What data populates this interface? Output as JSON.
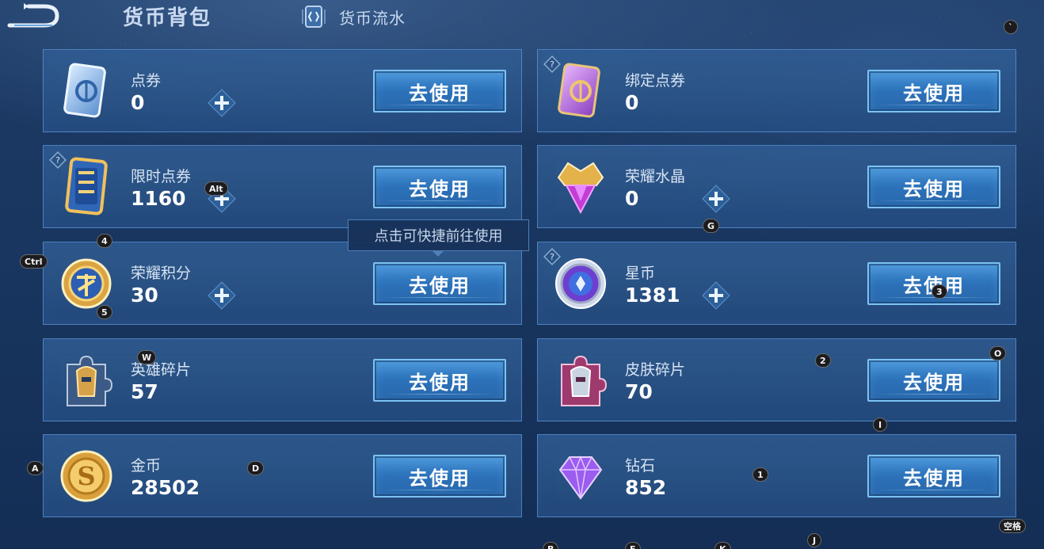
{
  "header": {
    "title": "货币背包",
    "ledger_label": "货币流水"
  },
  "cards": [
    {
      "name": "点券",
      "amount": "0",
      "button": "去使用",
      "icon": "coupon-card-icon",
      "has_plus": true,
      "has_help": false
    },
    {
      "name": "绑定点券",
      "amount": "0",
      "button": "去使用",
      "icon": "bound-coupon-icon",
      "has_plus": false,
      "has_help": true
    },
    {
      "name": "限时点券",
      "amount": "1160",
      "button": "去使用",
      "icon": "limited-coupon-icon",
      "has_plus": true,
      "has_help": true
    },
    {
      "name": "荣耀水晶",
      "amount": "0",
      "button": "去使用",
      "icon": "glory-crystal-icon",
      "has_plus": true,
      "has_help": false
    },
    {
      "name": "荣耀积分",
      "amount": "30",
      "button": "去使用",
      "icon": "glory-points-icon",
      "has_plus": true,
      "has_help": false
    },
    {
      "name": "星币",
      "amount": "1381",
      "button": "去使用",
      "icon": "star-coin-icon",
      "has_plus": true,
      "has_help": true
    },
    {
      "name": "英雄碎片",
      "amount": "57",
      "button": "去使用",
      "icon": "hero-fragment-icon",
      "has_plus": false,
      "has_help": false
    },
    {
      "name": "皮肤碎片",
      "amount": "70",
      "button": "去使用",
      "icon": "skin-fragment-icon",
      "has_plus": false,
      "has_help": false
    },
    {
      "name": "金币",
      "amount": "28502",
      "button": "去使用",
      "icon": "gold-coin-icon",
      "has_plus": false,
      "has_help": false
    },
    {
      "name": "钻石",
      "amount": "852",
      "button": "去使用",
      "icon": "diamond-icon",
      "has_plus": false,
      "has_help": false
    }
  ],
  "tooltip": {
    "text": "点击可快捷前往使用"
  },
  "key_hints": [
    "Ctrl",
    "Alt",
    "4",
    "5",
    "W",
    "A",
    "D",
    "G",
    "3",
    "2",
    "O",
    "I",
    "1",
    "J",
    "空格",
    "B",
    "E",
    "K",
    "`"
  ],
  "colors": {
    "accent": "#3c8bd2",
    "button_border": "#7cc2f3",
    "background": "#183660"
  }
}
